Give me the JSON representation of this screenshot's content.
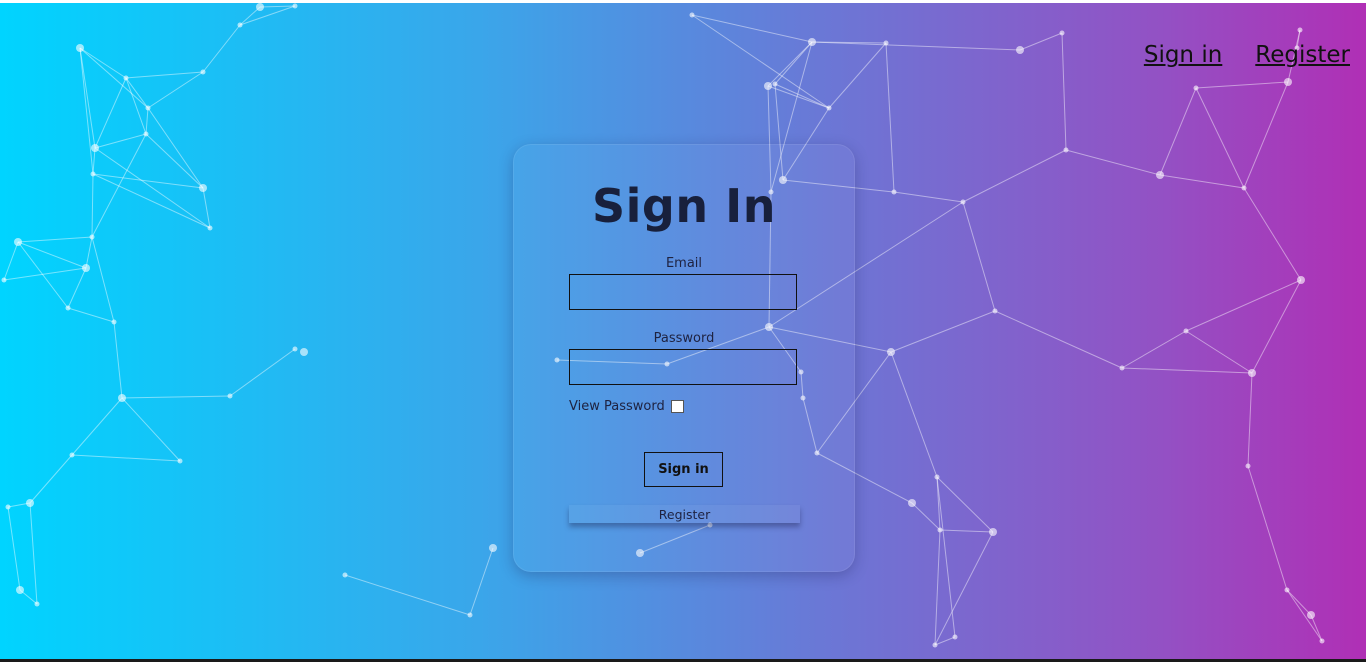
{
  "nav": {
    "signin_label": "Sign in",
    "register_label": "Register"
  },
  "form": {
    "title": "Sign In",
    "email_label": "Email",
    "email_value": "",
    "password_label": "Password",
    "password_value": "",
    "view_password_label": "View Password",
    "view_password_checked": false,
    "signin_button_label": "Sign in",
    "register_button_label": "Register"
  },
  "colors": {
    "gradient_start": "#00d4ff",
    "gradient_end": "#b02fb5",
    "text_dark": "#18203c"
  }
}
